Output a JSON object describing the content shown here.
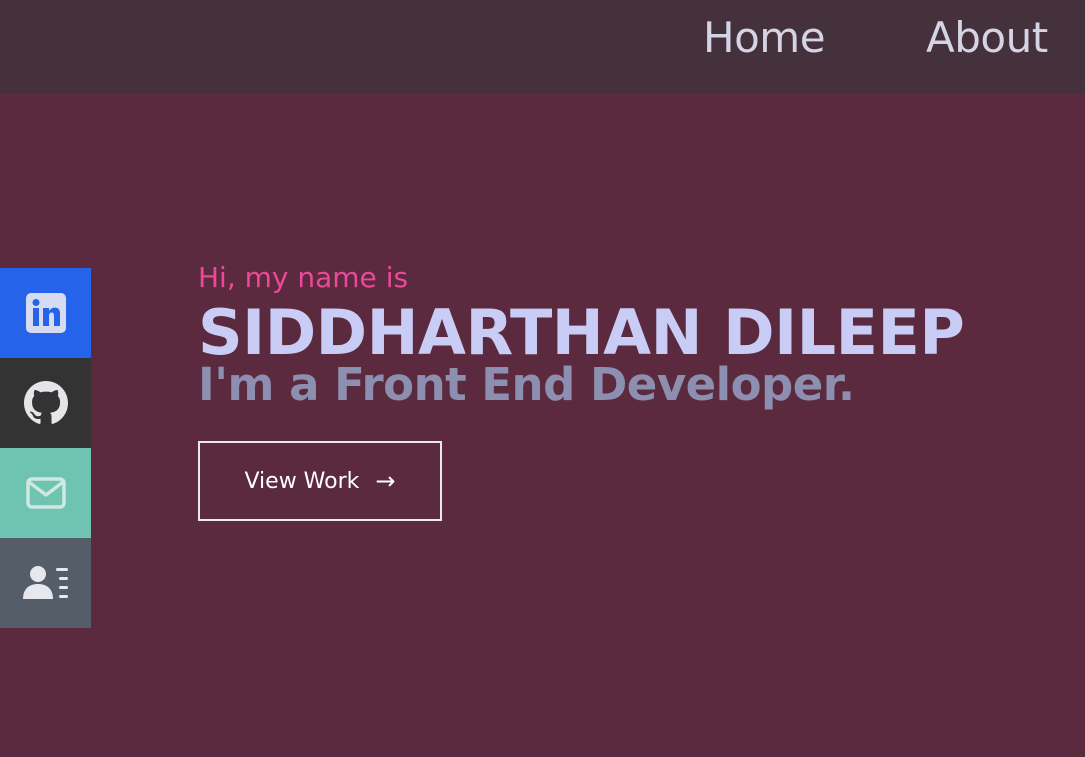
{
  "nav": {
    "home_label": "Home",
    "about_label": "About"
  },
  "social": {
    "items": [
      {
        "icon": "linkedin-icon",
        "color": "#2563eb"
      },
      {
        "icon": "github-icon",
        "color": "#333333"
      },
      {
        "icon": "mail-icon",
        "color": "#6ec4b0"
      },
      {
        "icon": "resume-icon",
        "color": "#555d68"
      }
    ]
  },
  "hero": {
    "greeting": "Hi, my name is",
    "name": "SIDDHARTHAN DILEEP",
    "tagline": "I'm a Front End Developer.",
    "cta_label": "View Work",
    "cta_arrow": "→"
  },
  "colors": {
    "background": "#5b2a3e",
    "navbar": "#45313c",
    "accent_pink": "#ec4899",
    "name_color": "#c9cdf6",
    "tagline_color": "#8d8fb0"
  }
}
